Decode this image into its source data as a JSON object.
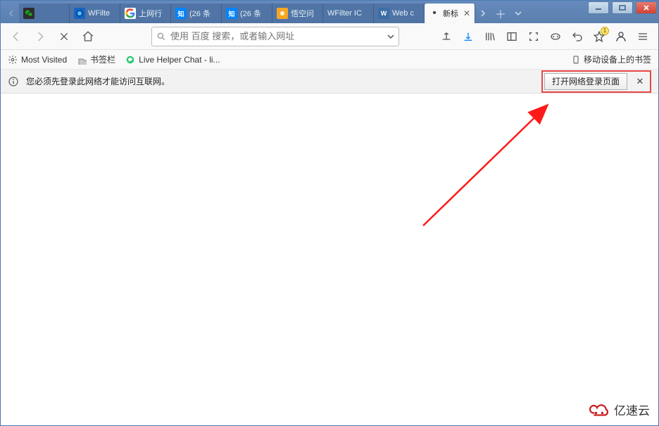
{
  "tabs": [
    {
      "label": "",
      "favicon": "wechat"
    },
    {
      "label": "WFilte",
      "favicon": "wfilter"
    },
    {
      "label": "上网行",
      "favicon": "google"
    },
    {
      "label": "(26 条",
      "favicon": "zhihu"
    },
    {
      "label": "(26 条",
      "favicon": "zhihu"
    },
    {
      "label": "悟空问",
      "favicon": "wukong"
    },
    {
      "label": "WFilter IC",
      "favicon": "none"
    },
    {
      "label": "Web c",
      "favicon": "w"
    },
    {
      "label": "新标",
      "favicon": "dot",
      "active": true,
      "unsaved": true
    }
  ],
  "addressbar": {
    "placeholder": "使用 百度 搜索，或者输入网址"
  },
  "bookmarks": {
    "most_visited": "Most Visited",
    "folder": "书签栏",
    "livehelper": "Live Helper Chat - li...",
    "mobile": "移动设备上的书签"
  },
  "notification": {
    "message": "您必须先登录此网络才能访问互联网。",
    "action": "打开网络登录页面"
  },
  "toolbar_icons": {
    "badge_count": "1"
  },
  "watermark": {
    "text": "亿速云"
  }
}
